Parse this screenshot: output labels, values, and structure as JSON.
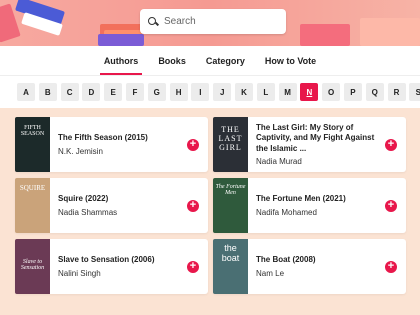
{
  "search": {
    "placeholder": "Search"
  },
  "nav": {
    "tabs": [
      {
        "label": "Authors",
        "active": true
      },
      {
        "label": "Books",
        "active": false
      },
      {
        "label": "Category",
        "active": false
      },
      {
        "label": "How to Vote",
        "active": false
      }
    ]
  },
  "letters": {
    "items": [
      "A",
      "B",
      "C",
      "D",
      "E",
      "F",
      "G",
      "H",
      "I",
      "J",
      "K",
      "L",
      "M",
      "N",
      "O",
      "P",
      "Q",
      "R",
      "S"
    ],
    "active": "N"
  },
  "books": [
    {
      "title": "The Fifth Season (2015)",
      "author": "N.K. Jemisin",
      "cover_text": "FIFTH SEASON",
      "cover_color": "#1c2a2a"
    },
    {
      "title": "The Last Girl: My Story of Captivity, and My Fight Against the Islamic ...",
      "author": "Nadia Murad",
      "cover_text": "THE LAST GIRL",
      "cover_color": "#2b2f36"
    },
    {
      "title": "Squire (2022)",
      "author": "Nadia Shammas",
      "cover_text": "SQUIRE",
      "cover_color": "#caa37a"
    },
    {
      "title": "The Fortune Men (2021)",
      "author": "Nadifa Mohamed",
      "cover_text": "The Fortune Men",
      "cover_color": "#2f5a3c"
    },
    {
      "title": "Slave to Sensation (2006)",
      "author": "Nalini Singh",
      "cover_text": "Slave to Sensation",
      "cover_color": "#6b3a55"
    },
    {
      "title": "The Boat (2008)",
      "author": "Nam Le",
      "cover_text": "the boat",
      "cover_color": "#4a6f73"
    }
  ],
  "add_symbol": "+"
}
